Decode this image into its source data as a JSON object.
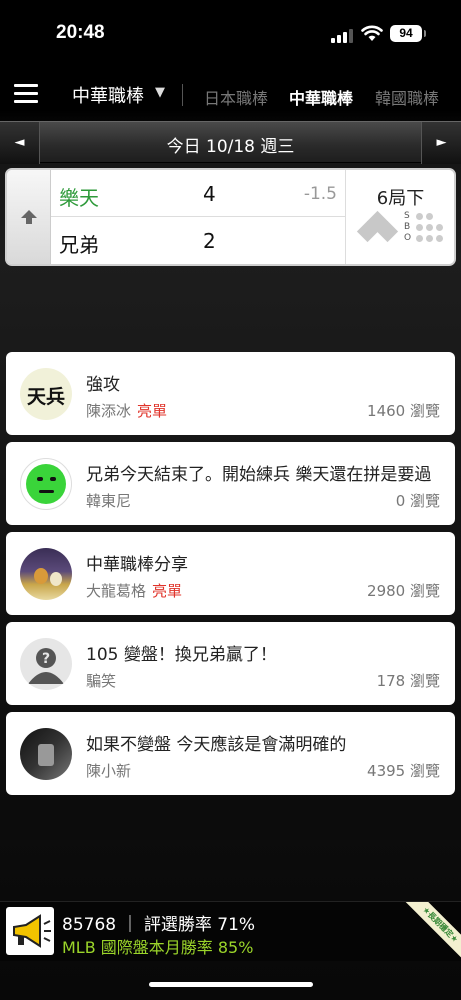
{
  "status_bar": {
    "time": "20:48",
    "battery": "94"
  },
  "nav": {
    "league_selected": "中華職棒",
    "dropdown_arrow": "▼",
    "tabs": [
      {
        "label": "日本職棒",
        "active": false
      },
      {
        "label": "中華職棒",
        "active": true
      },
      {
        "label": "韓國職棒",
        "active": false
      }
    ]
  },
  "date_bar": {
    "prev": "◄",
    "label": "今日 10/18 週三",
    "next": "►"
  },
  "game": {
    "teams": [
      {
        "name": "樂天",
        "score": "4",
        "odds": "-1.5",
        "color": "#2e9a3a"
      },
      {
        "name": "兄弟",
        "score": "2",
        "odds": "",
        "color": "#111111"
      }
    ],
    "inning": "6局下",
    "sbo": [
      "S",
      "B",
      "O"
    ]
  },
  "posts": [
    {
      "title": "強攻",
      "author": "陳添冰",
      "badge": "亮單",
      "views": "1460 瀏覽",
      "avatar_text": "天兵"
    },
    {
      "title": "兄弟今天結束了。開始練兵  樂天還在拼是要過",
      "author": "韓東尼",
      "badge": "",
      "views": "0 瀏覽"
    },
    {
      "title": "中華職棒分享",
      "author": "大龍葛格",
      "badge": "亮單",
      "views": "2980 瀏覽"
    },
    {
      "title": "105 變盤！換兄弟贏了！",
      "author": "騙笑",
      "badge": "",
      "views": "178 瀏覽"
    },
    {
      "title": "如果不變盤 今天應該是會滿明確的",
      "author": "陳小新",
      "badge": "",
      "views": "4395 瀏覽"
    }
  ],
  "banner": {
    "line1": "85768 ｜ 評選勝率 71%",
    "line2": "MLB 國際盤本月勝率 85%",
    "ribbon": "★長期穩定★"
  }
}
